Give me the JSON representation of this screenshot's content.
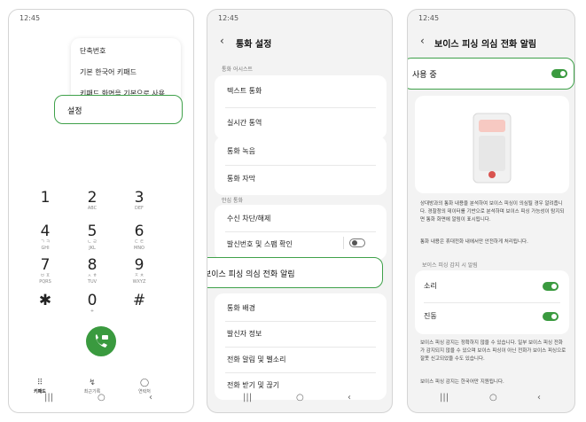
{
  "status_time": "12:45",
  "phone1": {
    "menu_items": [
      "단축번호",
      "기본 한국어 키패드",
      "키패드 화면을 기본으로 사용"
    ],
    "settings_label": "설정",
    "keys": [
      {
        "digit": "1",
        "letters": ""
      },
      {
        "digit": "2",
        "letters": "ABC"
      },
      {
        "digit": "3",
        "letters": "DEF"
      },
      {
        "digit": "4",
        "letters": "ㄱ ㅋ\nGHI"
      },
      {
        "digit": "5",
        "letters": "ㄴ ㄹ\nJKL"
      },
      {
        "digit": "6",
        "letters": "ㄷ ㅌ\nMNO"
      },
      {
        "digit": "7",
        "letters": "ㅂ ㅍ\nPQRS"
      },
      {
        "digit": "8",
        "letters": "ㅅ ㅎ\nTUV"
      },
      {
        "digit": "9",
        "letters": "ㅈ ㅊ\nWXYZ"
      },
      {
        "digit": "✱",
        "letters": ""
      },
      {
        "digit": "0",
        "letters": "+"
      },
      {
        "digit": "#",
        "letters": ""
      }
    ],
    "tabs": [
      {
        "icon": "keypad-icon",
        "label": "키패드"
      },
      {
        "icon": "recents-icon",
        "label": "최근기록"
      },
      {
        "icon": "contacts-icon",
        "label": "연락처"
      }
    ]
  },
  "phone2": {
    "title": "통화 설정",
    "section1": "통화 어시스트",
    "items1": [
      "텍스트 통화",
      "실시간 통역"
    ],
    "items2": [
      "통화 녹음",
      "통화 자막"
    ],
    "section2": "안심 통화",
    "items3": [
      "수신 차단/해제",
      "발신번호 및 스팸 확인"
    ],
    "highlight": "보이스 피싱 의심 전화 알림",
    "items4": [
      "통화 배경",
      "발신자 정보",
      "전화 알림 및 벨소리",
      "전화 받기 및 끊기"
    ]
  },
  "phone3": {
    "title": "보이스 피싱 의심 전화 알림",
    "in_use": "사용 중",
    "description1": "상대방과의 통화 내용을 분석하여 보이스 피싱이 의심될 경우 알려줍니다. 경찰청의 데이터를 기반으로 분석하며 보이스 피싱 가능성이 탐지되면 통화 화면에 알림이 표시됩니다.",
    "description2": "통화 내용은 휴대전화 내에서만 안전하게 처리됩니다.",
    "section": "보이스 피싱 감지 시 알림",
    "options": [
      "소리",
      "진동"
    ],
    "footer1": "보이스 피싱 감지는 정확하지 않을 수 있습니다. 일부 보이스 피싱 전화가 감지되지 않을 수 있으며 보이스 피싱이 아닌 전화가 보이스 피싱으로 잘못 신고되었을 수도 있습니다.",
    "footer2": "보이스 피싱 감지는 한국어만 지원됩니다."
  },
  "colors": {
    "accent_green": "#3a9a3f",
    "highlight_border": "#3fa14a"
  }
}
